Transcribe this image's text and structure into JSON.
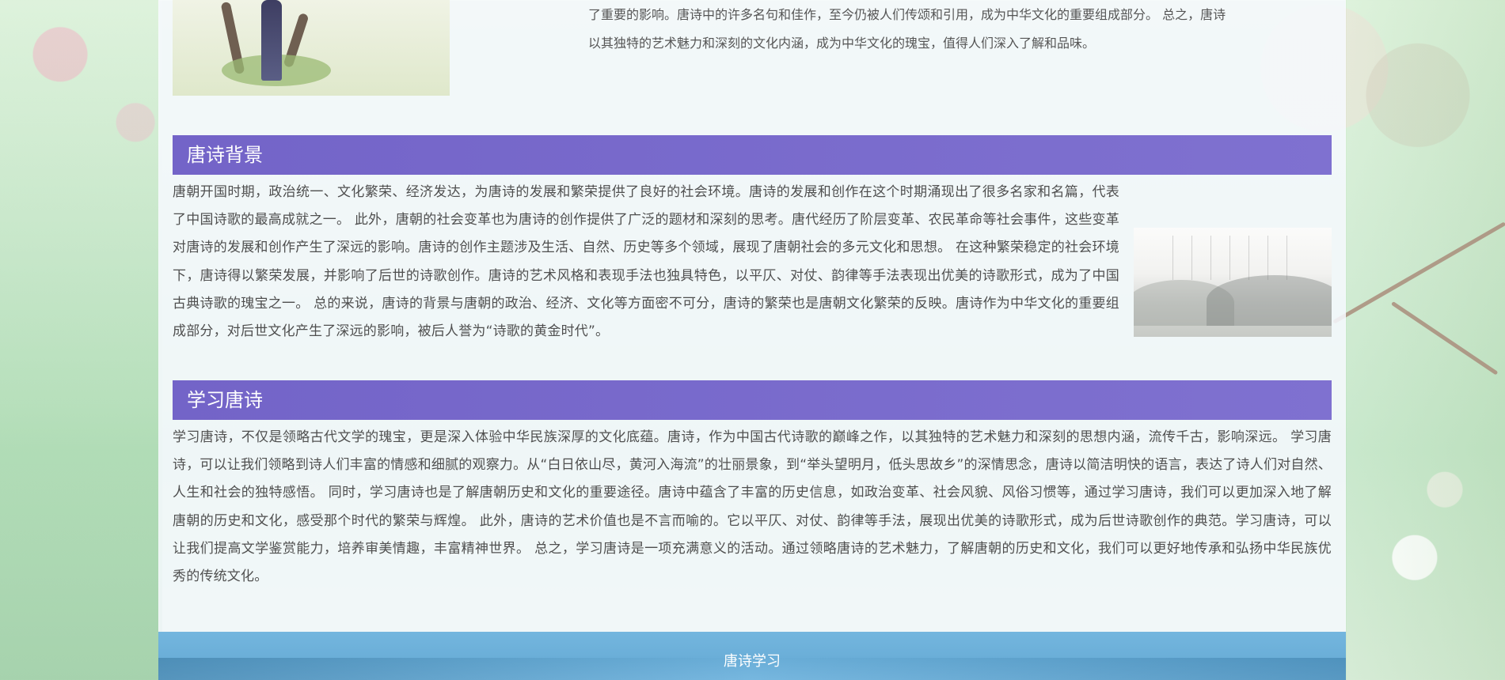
{
  "intro": {
    "text": "了重要的影响。唐诗中的许多名句和佳作，至今仍被人们传颂和引用，成为中华文化的重要组成部分。 总之，唐诗以其独特的艺术魅力和深刻的文化内涵，成为中华文化的瑰宝，值得人们深入了解和品味。"
  },
  "sections": [
    {
      "title": "唐诗背景",
      "text": "唐朝开国时期，政治统一、文化繁荣、经济发达，为唐诗的发展和繁荣提供了良好的社会环境。唐诗的发展和创作在这个时期涌现出了很多名家和名篇，代表了中国诗歌的最高成就之一。 此外，唐朝的社会变革也为唐诗的创作提供了广泛的题材和深刻的思考。唐代经历了阶层变革、农民革命等社会事件，这些变革对唐诗的发展和创作产生了深远的影响。唐诗的创作主题涉及生活、自然、历史等多个领域，展现了唐朝社会的多元文化和思想。 在这种繁荣稳定的社会环境下，唐诗得以繁荣发展，并影响了后世的诗歌创作。唐诗的艺术风格和表现手法也独具特色，以平仄、对仗、韵律等手法表现出优美的诗歌形式，成为了中国古典诗歌的瑰宝之一。 总的来说，唐诗的背景与唐朝的政治、经济、文化等方面密不可分，唐诗的繁荣也是唐朝文化繁荣的反映。唐诗作为中华文化的重要组成部分，对后世文化产生了深远的影响，被后人誉为“诗歌的黄金时代”。"
    },
    {
      "title": "学习唐诗",
      "text": "学习唐诗，不仅是领略古代文学的瑰宝，更是深入体验中华民族深厚的文化底蕴。唐诗，作为中国古代诗歌的巅峰之作，以其独特的艺术魅力和深刻的思想内涵，流传千古，影响深远。 学习唐诗，可以让我们领略到诗人们丰富的情感和细腻的观察力。从“白日依山尽，黄河入海流”的壮丽景象，到“举头望明月，低头思故乡”的深情思念，唐诗以简洁明快的语言，表达了诗人们对自然、人生和社会的独特感悟。 同时，学习唐诗也是了解唐朝历史和文化的重要途径。唐诗中蕴含了丰富的历史信息，如政治变革、社会风貌、风俗习惯等，通过学习唐诗，我们可以更加深入地了解唐朝的历史和文化，感受那个时代的繁荣与辉煌。 此外，唐诗的艺术价值也是不言而喻的。它以平仄、对仗、韵律等手法，展现出优美的诗歌形式，成为后世诗歌创作的典范。学习唐诗，可以让我们提高文学鉴赏能力，培养审美情趣，丰富精神世界。 总之，学习唐诗是一项充满意义的活动。通过领略唐诗的艺术魅力，了解唐朝的历史和文化，我们可以更好地传承和弘扬中华民族优秀的传统文化。"
    }
  ],
  "footer": {
    "text": "唐诗学习"
  },
  "colors": {
    "section_bar": "#7766c9",
    "footer": "#70b4dd",
    "content_bg": "#f7f9ff",
    "text": "#4f4f4f"
  },
  "images": {
    "hero": "poet-illustration",
    "background_section": "ink-landscape-painting"
  }
}
